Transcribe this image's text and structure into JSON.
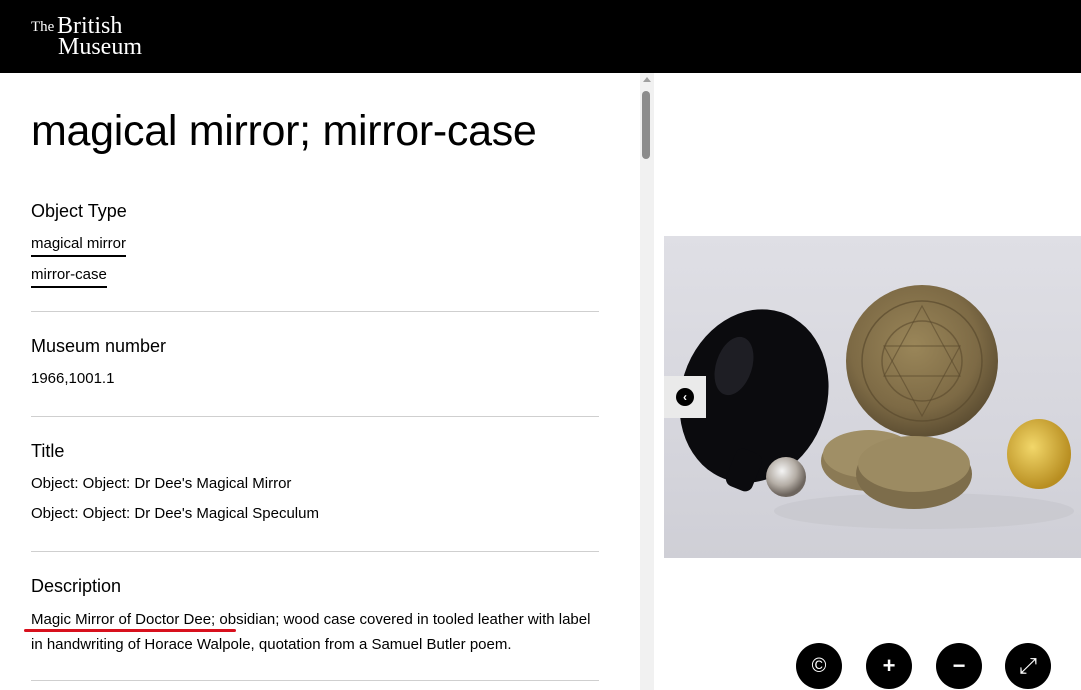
{
  "header": {
    "logo_the": "The",
    "logo_british": "British",
    "logo_museum": "Museum"
  },
  "object": {
    "title": "magical mirror; mirror-case",
    "object_type_heading": "Object Type",
    "object_types": [
      "magical mirror",
      "mirror-case"
    ],
    "museum_number_heading": "Museum number",
    "museum_number": "1966,1001.1",
    "title_heading": "Title",
    "titles": [
      "Object: Object: Dr Dee's Magical Mirror",
      "Object: Object: Dr Dee's Magical Speculum"
    ],
    "description_heading": "Description",
    "description_highlight": "Magic Mirror of Doctor Dee",
    "description_rest": "; obsidian; wood case covered in tooled leather with label in handwriting of Horace Walpole, quotation from a Samuel Butler poem."
  },
  "viewer": {
    "prev_icon": "chevron-left-icon",
    "controls": [
      {
        "name": "copyright-icon",
        "glyph": "©"
      },
      {
        "name": "zoom-in-icon",
        "glyph": "+"
      },
      {
        "name": "zoom-out-icon",
        "glyph": "−"
      },
      {
        "name": "fullscreen-icon",
        "glyph": "⤢"
      }
    ]
  },
  "colors": {
    "header_bg": "#000000",
    "highlight_underline": "#d8101d"
  }
}
